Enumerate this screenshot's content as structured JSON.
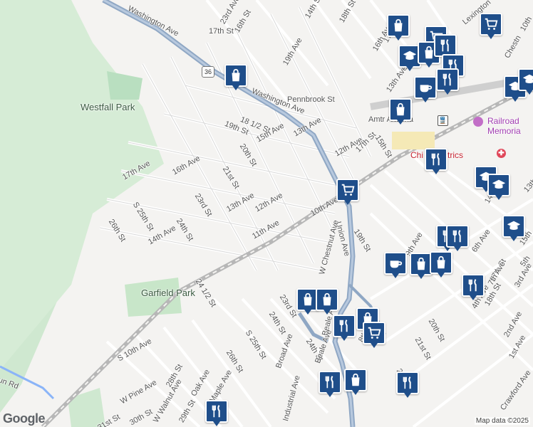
{
  "map": {
    "parks": {
      "westfall": "Westfall Park",
      "garfield": "Garfield Park"
    },
    "route_shield": "36",
    "places": {
      "railroad_memorial_line1": "Railroad",
      "railroad_memorial_line2": "Memoria",
      "childrens_pediatrics": "Chi Pediatrics",
      "amtrak": "Amtr Altoona"
    },
    "streets": [
      {
        "text": "Washington Ave"
      },
      {
        "text": "23rd Ave"
      },
      {
        "text": "16th St"
      },
      {
        "text": "17th St"
      },
      {
        "text": "14th St"
      },
      {
        "text": "18th St"
      },
      {
        "text": "17th Ave"
      },
      {
        "text": "16th Ave"
      },
      {
        "text": "19th Ave"
      },
      {
        "text": "Pennbrook St"
      },
      {
        "text": "Washington Ave"
      },
      {
        "text": "18 1/2 St"
      },
      {
        "text": "19th St"
      },
      {
        "text": "15th Ave"
      },
      {
        "text": "20th St"
      },
      {
        "text": "13th Ave"
      },
      {
        "text": "12th Ave"
      },
      {
        "text": "17th St"
      },
      {
        "text": "15th St"
      },
      {
        "text": "13th Ave Alley"
      },
      {
        "text": "Lexington"
      },
      {
        "text": "Chestn"
      },
      {
        "text": "10th"
      },
      {
        "text": "17th Ave"
      },
      {
        "text": "16th Ave"
      },
      {
        "text": "21st St"
      },
      {
        "text": "S 25th St"
      },
      {
        "text": "23rd St"
      },
      {
        "text": "13th Ave"
      },
      {
        "text": "12th Ave"
      },
      {
        "text": "26th St"
      },
      {
        "text": "14th Ave"
      },
      {
        "text": "24th St"
      },
      {
        "text": "11th Ave"
      },
      {
        "text": "10th Ave"
      },
      {
        "text": "Union Ave"
      },
      {
        "text": "W Chestnut Ave"
      },
      {
        "text": "19th St"
      },
      {
        "text": "9th Ave"
      },
      {
        "text": "6th Ave"
      },
      {
        "text": "14th St"
      },
      {
        "text": "13th"
      },
      {
        "text": "15th"
      },
      {
        "text": "5th"
      },
      {
        "text": "3rd Ave"
      },
      {
        "text": "24 1/2 St"
      },
      {
        "text": "23rd St"
      },
      {
        "text": "24th St"
      },
      {
        "text": "S 25th St"
      },
      {
        "text": "Beale Ave"
      },
      {
        "text": "24th St"
      },
      {
        "text": "Broad Ave"
      },
      {
        "text": "Beale Ave"
      },
      {
        "text": "26th St"
      },
      {
        "text": "8th"
      },
      {
        "text": "20th St"
      },
      {
        "text": "21st St"
      },
      {
        "text": "4th Ave"
      },
      {
        "text": "18th St"
      },
      {
        "text": "17th St"
      },
      {
        "text": "2nd Ave"
      },
      {
        "text": "1st Ave"
      },
      {
        "text": "22nd St"
      },
      {
        "text": "Crawford Ave"
      },
      {
        "text": "S 10th Ave"
      },
      {
        "text": "W Pine Ave"
      },
      {
        "text": "28th St"
      },
      {
        "text": "Oak Ave"
      },
      {
        "text": "Maple Ave"
      },
      {
        "text": "W Walnut Ave"
      },
      {
        "text": "29th St"
      },
      {
        "text": "30th St"
      },
      {
        "text": "31st St"
      },
      {
        "text": "un Rd"
      },
      {
        "text": "Industrial Ave"
      },
      {
        "text": "7th Ave"
      }
    ],
    "pois": [
      {
        "type": "shopping"
      },
      {
        "type": "shopping"
      },
      {
        "type": "grocery"
      },
      {
        "type": "grocery"
      },
      {
        "type": "school"
      },
      {
        "type": "shopping"
      },
      {
        "type": "restaurant"
      },
      {
        "type": "restaurant"
      },
      {
        "type": "cafe"
      },
      {
        "type": "restaurant"
      },
      {
        "type": "school"
      },
      {
        "type": "shopping"
      },
      {
        "type": "grocery"
      },
      {
        "type": "restaurant"
      },
      {
        "type": "school"
      },
      {
        "type": "school"
      },
      {
        "type": "school"
      },
      {
        "type": "restaurant"
      },
      {
        "type": "restaurant"
      },
      {
        "type": "cafe"
      },
      {
        "type": "shopping"
      },
      {
        "type": "shopping"
      },
      {
        "type": "shopping"
      },
      {
        "type": "shopping"
      },
      {
        "type": "restaurant"
      },
      {
        "type": "shopping"
      },
      {
        "type": "grocery"
      },
      {
        "type": "restaurant"
      },
      {
        "type": "restaurant"
      },
      {
        "type": "shopping"
      },
      {
        "type": "restaurant"
      },
      {
        "type": "restaurant"
      },
      {
        "type": "school"
      }
    ],
    "colors": {
      "pin": "#1f4e8a",
      "park": "#cfe8d0",
      "road": "#ffffff",
      "highway": "#8fa7c4",
      "rail": "#b7b7b7"
    }
  },
  "branding": {
    "logo": "Google",
    "attribution": "Map data ©2025"
  }
}
